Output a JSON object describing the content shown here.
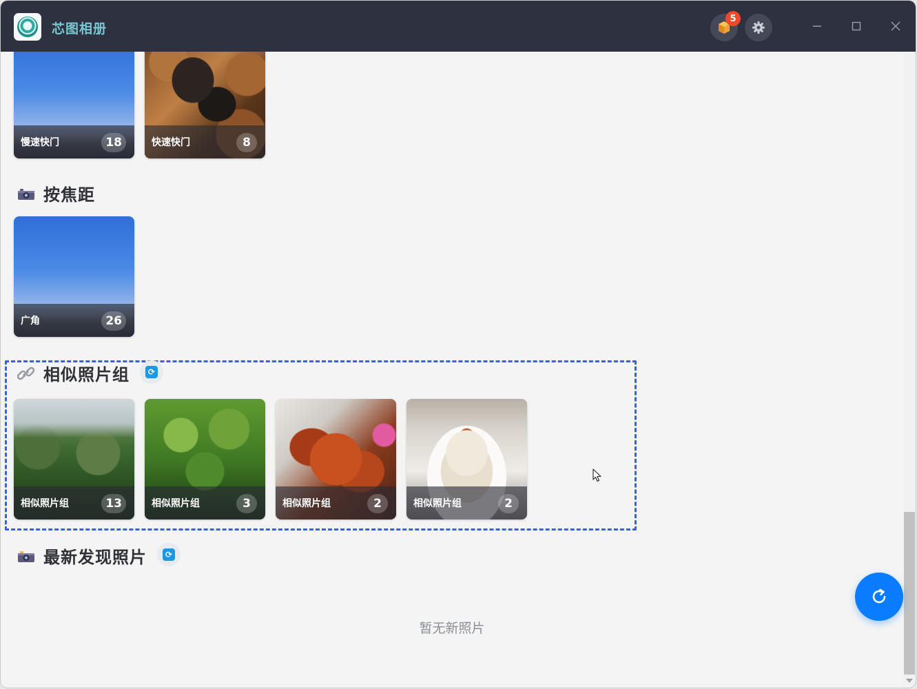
{
  "window": {
    "title": "芯图相册",
    "notification_count": "5"
  },
  "sections": {
    "shutter": {
      "cards": [
        {
          "label": "慢速快门",
          "count": "18"
        },
        {
          "label": "快速快门",
          "count": "8"
        }
      ]
    },
    "focal": {
      "title": "按焦距",
      "cards": [
        {
          "label": "广角",
          "count": "26"
        }
      ]
    },
    "similar": {
      "title": "相似照片组",
      "cards": [
        {
          "label": "相似照片组",
          "count": "13"
        },
        {
          "label": "相似照片组",
          "count": "3"
        },
        {
          "label": "相似照片组",
          "count": "2"
        },
        {
          "label": "相似照片组",
          "count": "2"
        }
      ]
    },
    "recent": {
      "title": "最新发现照片",
      "empty_text": "暂无新照片"
    }
  },
  "icons": {
    "app": "app-logo-icon",
    "plugin": "package-icon",
    "settings": "gear-icon",
    "minimize": "minimize-icon",
    "maximize": "maximize-icon",
    "close": "close-icon",
    "camera": "camera-icon",
    "link": "link-icon",
    "refresh": "refresh-icon"
  },
  "colors": {
    "titlebar": "#2e3140",
    "accent": "#0a7cff",
    "badge": "#f04a2a",
    "title_text": "#79c8cf",
    "selection_border": "#3a5fe0"
  }
}
